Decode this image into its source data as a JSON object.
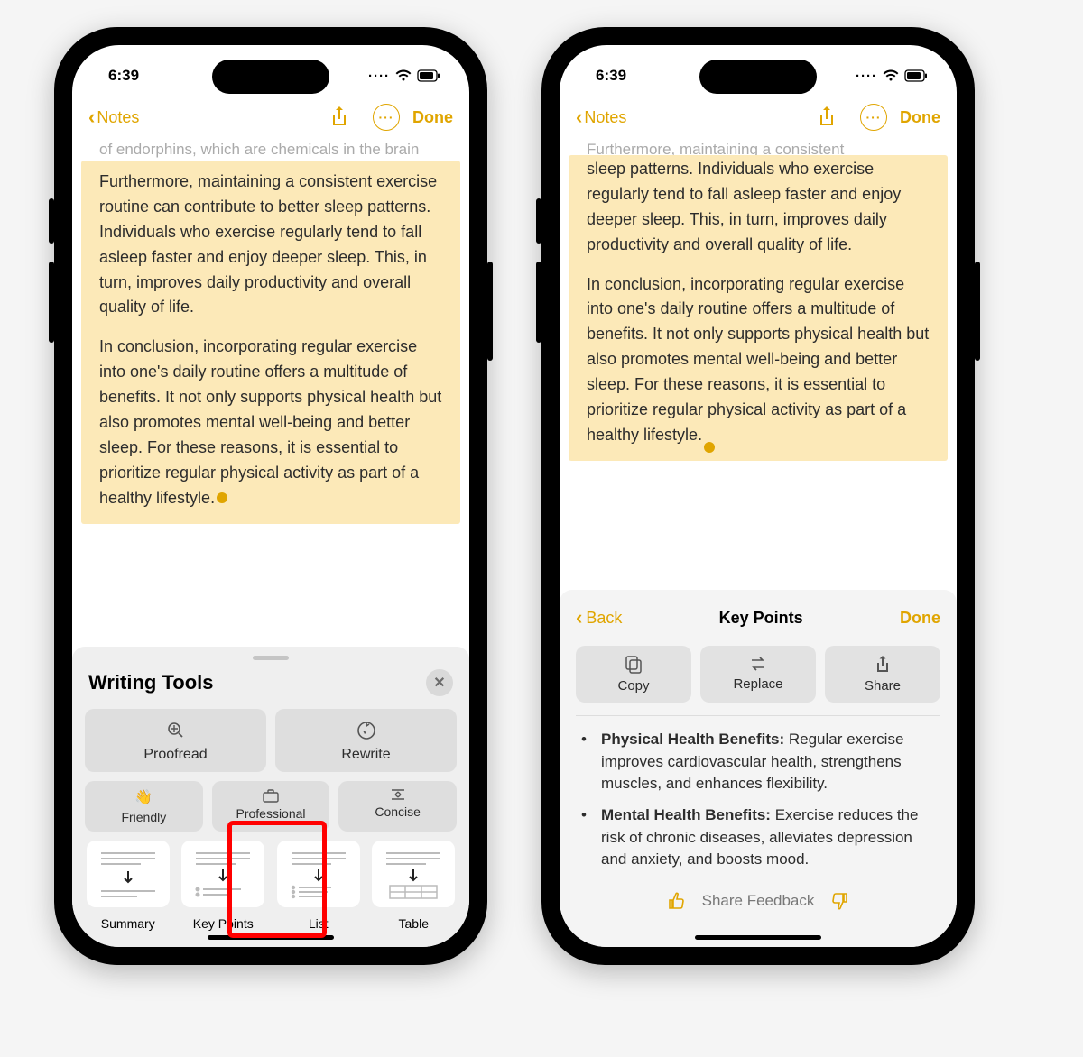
{
  "status": {
    "time": "6:39"
  },
  "nav": {
    "back_label": "Notes",
    "done_label": "Done"
  },
  "note": {
    "faded_preview": "of endorphins, which are chemicals in the brain",
    "para1": "Furthermore, maintaining a consistent exercise routine can contribute to better sleep patterns. Individuals who exercise regularly tend to fall asleep faster and enjoy deeper sleep. This, in turn, improves daily productivity and overall quality of life.",
    "para2": "In conclusion, incorporating regular exercise into one's daily routine offers a multitude of benefits. It not only supports physical health but also promotes mental well-being and better sleep. For these reasons, it is essential to prioritize regular physical activity as part of a healthy lifestyle.",
    "r_para1_partial": "sleep patterns. Individuals who exercise regularly tend to fall asleep faster and enjoy deeper sleep. This, in turn, improves daily productivity and overall quality of life."
  },
  "writing_tools": {
    "title": "Writing Tools",
    "proofread": "Proofread",
    "rewrite": "Rewrite",
    "friendly": "Friendly",
    "professional": "Professional",
    "concise": "Concise",
    "summary": "Summary",
    "keypoints": "Key Points",
    "list": "List",
    "table": "Table"
  },
  "result": {
    "back": "Back",
    "title": "Key Points",
    "done": "Done",
    "copy": "Copy",
    "replace": "Replace",
    "share": "Share",
    "kp1_title": "Physical Health Benefits:",
    "kp1_body": " Regular exercise improves cardiovascular health, strengthens muscles, and enhances flexibility.",
    "kp2_title": "Mental Health Benefits:",
    "kp2_body": " Exercise reduces the risk of chronic diseases, alleviates depression and anxiety, and boosts mood.",
    "feedback": "Share Feedback"
  }
}
